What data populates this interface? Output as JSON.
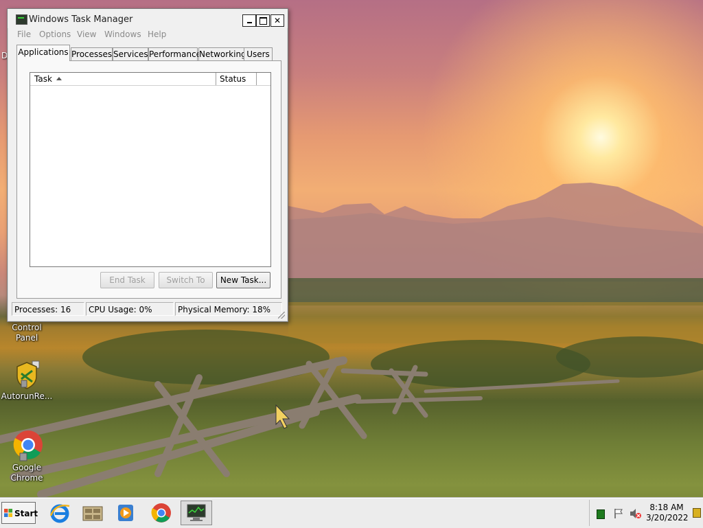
{
  "window": {
    "title": "Windows Task Manager",
    "minimize": "_",
    "maximize": "□",
    "close": "✕"
  },
  "menu": [
    "File",
    "Options",
    "View",
    "Windows",
    "Help"
  ],
  "tabs": [
    {
      "label": "Applications",
      "active": true
    },
    {
      "label": "Processes",
      "active": false
    },
    {
      "label": "Services",
      "active": false
    },
    {
      "label": "Performance",
      "active": false
    },
    {
      "label": "Networking",
      "active": false
    },
    {
      "label": "Users",
      "active": false
    }
  ],
  "task_list": {
    "columns": [
      "Task",
      "Status"
    ],
    "sort_column": "Task",
    "rows": []
  },
  "buttons": {
    "end_task": "End Task",
    "switch_to": "Switch To",
    "new_task": "New Task..."
  },
  "status_bar": {
    "processes": "Processes: 16",
    "cpu": "CPU Usage: 0%",
    "memory": "Physical Memory: 18%"
  },
  "desktop_icons": [
    {
      "label": "Control Panel",
      "icon": "control-panel-icon"
    },
    {
      "label": "AutorunRe...",
      "icon": "autoruns-shield-icon"
    },
    {
      "label": "Google Chrome",
      "icon": "chrome-icon"
    }
  ],
  "partial_left_text": "D",
  "taskbar": {
    "start_label": "Start",
    "pinned": [
      "internet-explorer-icon",
      "file-cabinet-icon",
      "media-player-icon",
      "chrome-icon",
      "task-manager-icon"
    ],
    "tray_icons": [
      "network-icon",
      "flag-icon",
      "volume-muted-icon"
    ],
    "time": "8:18 AM",
    "date": "3/20/2022"
  },
  "colors": {
    "window_bg": "#f0f0f0",
    "taskbar_bg": "#ececec",
    "disabled_text": "#a0a0a0"
  }
}
